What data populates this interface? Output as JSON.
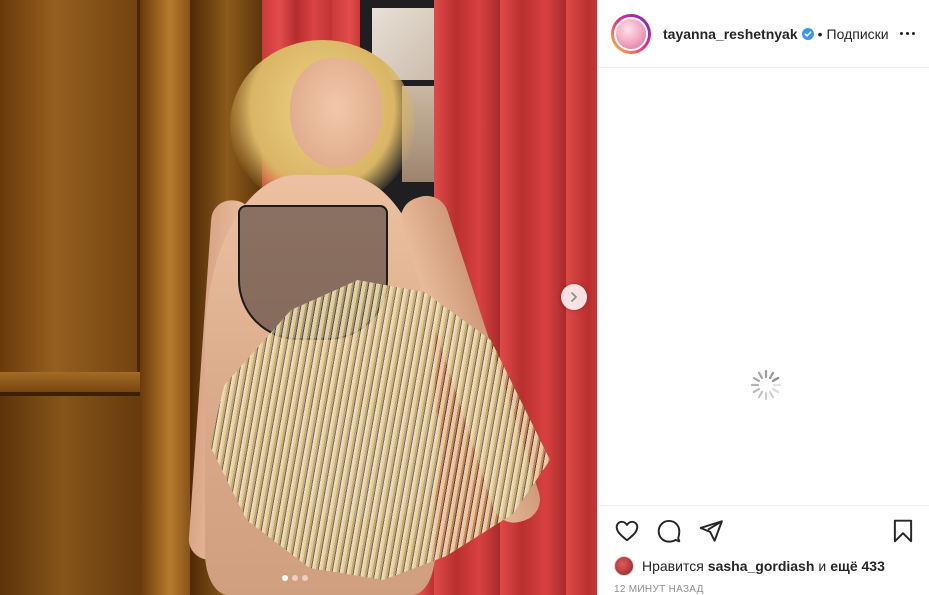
{
  "post": {
    "username": "tayanna_reshetnyak",
    "verified": true,
    "separator": "•",
    "follow_label": "Подписки",
    "more_icon": "more-horizontal-icon"
  },
  "media": {
    "carousel_dots": 3,
    "active_dot": 1,
    "next_icon": "chevron-right-icon"
  },
  "comments": {
    "state": "loading",
    "spinner_icon": "loading-spinner-icon"
  },
  "actions": {
    "like_icon": "heart-icon",
    "comment_icon": "comment-bubble-icon",
    "share_icon": "paper-plane-icon",
    "save_icon": "bookmark-icon"
  },
  "likes": {
    "prefix": "Нравится",
    "liker": "sasha_gordiash",
    "and_label": "и",
    "count_label": "ещё 433"
  },
  "timestamp": "12 МИНУТ НАЗАД",
  "colors": {
    "text": "#262626",
    "muted": "#8e8e8e",
    "verified": "#3897f0",
    "border": "#efefef"
  }
}
